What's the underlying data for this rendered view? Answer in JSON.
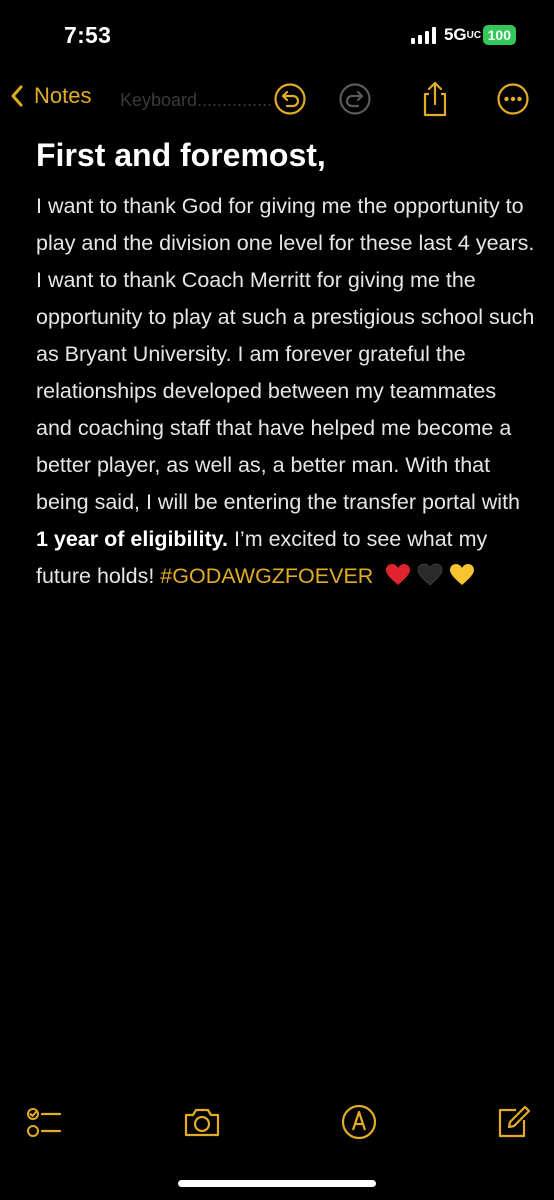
{
  "status_bar": {
    "time": "7:53",
    "network": "5G",
    "network_suffix": "UC",
    "battery": "100"
  },
  "nav": {
    "back_label": "Notes",
    "ghost_text": "Keyboard...............",
    "icons": [
      "chevron-left-icon",
      "undo-icon",
      "redo-icon",
      "share-icon",
      "more-icon"
    ]
  },
  "note": {
    "title": "First and foremost,",
    "body_plain": "I want to thank God for giving me the opportunity to play and the division one level for these last 4 years. I want to thank Coach Merritt for giving me the opportunity to play at such a prestigious school such as Bryant University. I am forever grateful the relationships developed between my teammates and coaching staff that have helped me become a better player, as well as, a better man. With that being said, I will be entering the transfer portal with ",
    "body_bold": "1 year of eligibility.",
    "body_after": " I’m excited to see what my future holds! ",
    "hashtag": "#GODAWGZFOEVER",
    "emojis": [
      "red-heart",
      "black-heart",
      "yellow-heart"
    ]
  },
  "toolbar": {
    "icons": [
      "checklist-icon",
      "camera-icon",
      "markup-icon",
      "compose-icon"
    ]
  },
  "colors": {
    "accent": "#e2ac24",
    "background": "#000000",
    "battery": "#34c759",
    "heart_red": "#e0242f",
    "heart_black": "#2a2a2a",
    "heart_yellow": "#f7c32e"
  }
}
